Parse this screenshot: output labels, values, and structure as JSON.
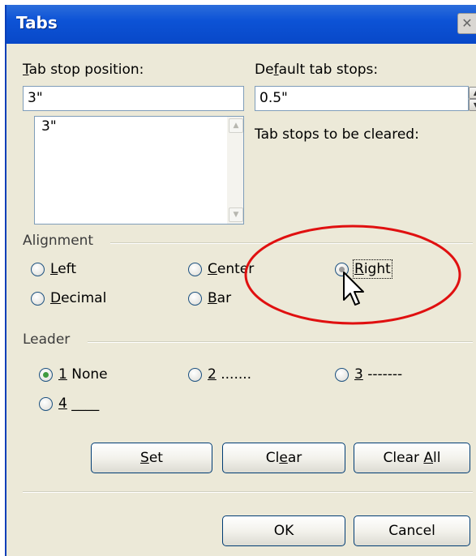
{
  "dialog": {
    "title": "Tabs",
    "close_icon": "close-icon"
  },
  "tab_stop": {
    "label_pre": "",
    "label_mnemonic": "T",
    "label_post": "ab stop position:",
    "value": "3\"",
    "list_items": [
      "3\""
    ]
  },
  "default_stops": {
    "label_pre": "De",
    "label_mnemonic": "f",
    "label_post": "ault tab stops:",
    "value": "0.5\""
  },
  "cleared_label": "Tab stops to be cleared:",
  "alignment": {
    "label": "Alignment",
    "options": [
      {
        "pre": "",
        "mn": "L",
        "post": "eft"
      },
      {
        "pre": "",
        "mn": "C",
        "post": "enter"
      },
      {
        "pre": "",
        "mn": "R",
        "post": "ight"
      },
      {
        "pre": "",
        "mn": "D",
        "post": "ecimal"
      },
      {
        "pre": "",
        "mn": "B",
        "post": "ar"
      }
    ],
    "selected": "Right"
  },
  "leader": {
    "label": "Leader",
    "options": [
      {
        "pre": "",
        "mn": "1",
        "post": " None"
      },
      {
        "pre": "",
        "mn": "2",
        "post": " ......."
      },
      {
        "pre": "",
        "mn": "3",
        "post": " -------"
      },
      {
        "pre": "",
        "mn": "4",
        "post": " ____"
      }
    ],
    "selected": "1 None"
  },
  "buttons": {
    "set": {
      "pre": "",
      "mn": "S",
      "post": "et"
    },
    "clear": {
      "pre": "Cl",
      "mn": "e",
      "post": "ar"
    },
    "clear_all": {
      "pre": "Clear ",
      "mn": "A",
      "post": "ll"
    },
    "ok": "OK",
    "cancel": "Cancel"
  },
  "colors": {
    "titlebar": "#0d53d6",
    "dialog_bg": "#ece9d8",
    "annotation_circle": "#e01010",
    "radio_selected_dot": "#3f9a3f"
  }
}
